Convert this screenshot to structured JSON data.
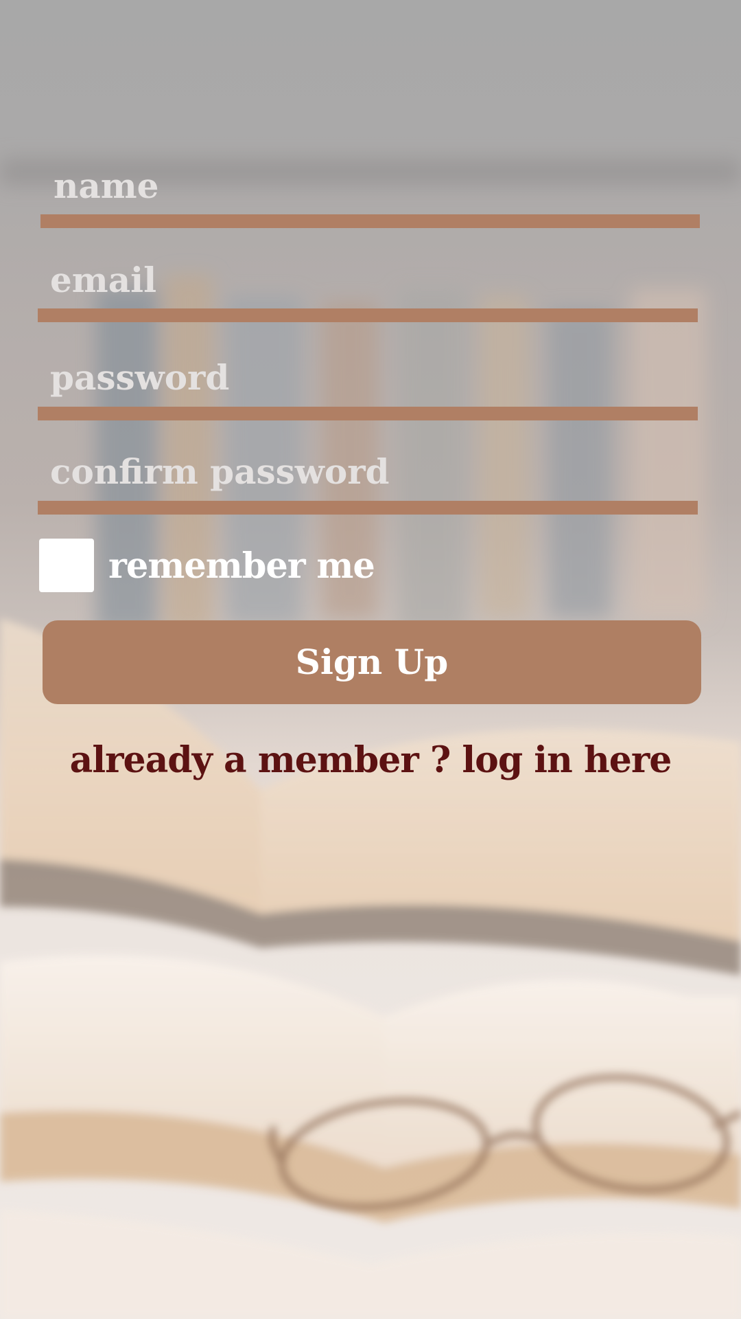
{
  "form": {
    "fields": [
      {
        "id": "name",
        "placeholder": "name",
        "value": ""
      },
      {
        "id": "email",
        "placeholder": "email",
        "value": ""
      },
      {
        "id": "password",
        "placeholder": "password",
        "value": ""
      },
      {
        "id": "confirm_password",
        "placeholder": "confirm password",
        "value": ""
      }
    ],
    "remember": {
      "label": "remember me",
      "checked": false
    },
    "signup_label": "Sign Up",
    "login_link": "already a member ? log in here"
  },
  "colors": {
    "accent": "#af7f63",
    "underline": "#b07f64",
    "placeholder_text": "#e4e1e0",
    "link_text": "#5c1212",
    "checkbox": "#ffffff"
  },
  "background": {
    "scene": "open books with reading glasses"
  }
}
